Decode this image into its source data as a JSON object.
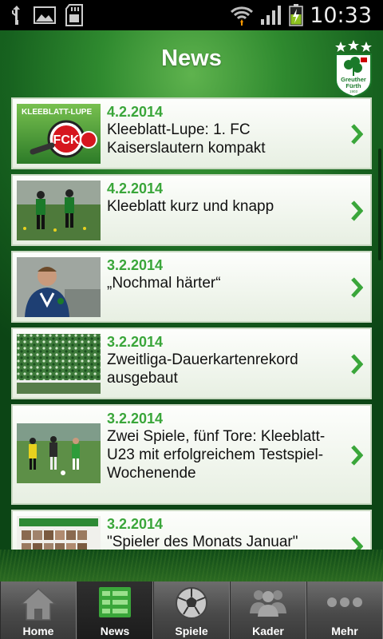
{
  "status_bar": {
    "time": "10:33",
    "icons": [
      "usb-icon",
      "image-icon",
      "sd-card-icon",
      "wifi-icon",
      "signal-icon",
      "battery-charging-icon"
    ]
  },
  "header": {
    "title": "News",
    "logo_text": "Greuther Fürth",
    "logo_top": "SpVgg",
    "logo_year": "1903"
  },
  "news": [
    {
      "date": "4.2.2014",
      "title": "Kleeblatt-Lupe: 1. FC Kaiserslautern kompakt",
      "thumb_text": "KLEEBLATT-LUPE"
    },
    {
      "date": "4.2.2014",
      "title": "Kleeblatt kurz und knapp"
    },
    {
      "date": "3.2.2014",
      "title": "„Nochmal härter“"
    },
    {
      "date": "3.2.2014",
      "title": "Zweitliga-Dauerkartenrekord ausgebaut"
    },
    {
      "date": "3.2.2014",
      "title": "Zwei Spiele, fünf Tore: Kleeblatt-U23 mit erfolgreichem Testspiel-Wochenende"
    },
    {
      "date": "3.2.2014",
      "title": "\"Spieler des Monats Januar\" gesucht!"
    }
  ],
  "tabs": [
    {
      "label": "Home",
      "icon": "home-icon"
    },
    {
      "label": "News",
      "icon": "news-list-icon",
      "active": true
    },
    {
      "label": "Spiele",
      "icon": "football-icon"
    },
    {
      "label": "Kader",
      "icon": "team-icon"
    },
    {
      "label": "Mehr",
      "icon": "more-icon"
    }
  ],
  "colors": {
    "accent_green": "#3aa63a",
    "tab_bar": "#4a4a4a"
  }
}
